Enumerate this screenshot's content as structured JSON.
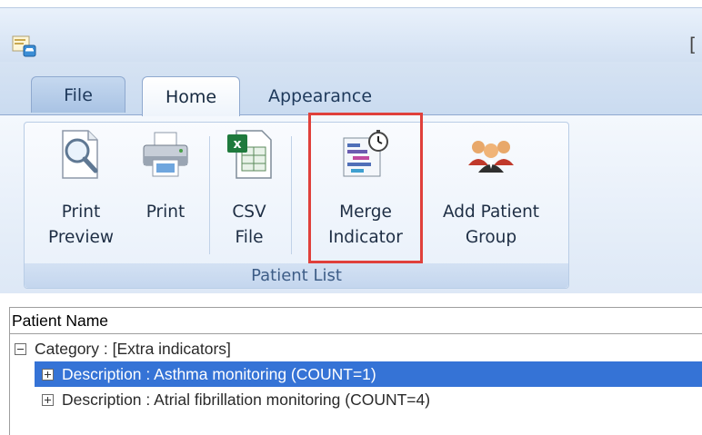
{
  "window": {
    "title_fragment": "["
  },
  "tabs": [
    {
      "label": "File"
    },
    {
      "label": "Home"
    },
    {
      "label": "Appearance"
    }
  ],
  "ribbon": {
    "group_caption": "Patient List",
    "buttons": [
      {
        "line1": "Print",
        "line2": "Preview",
        "icon": "print-preview-icon"
      },
      {
        "line1": "Print",
        "line2": "",
        "icon": "printer-icon"
      },
      {
        "line1": "CSV",
        "line2": "File",
        "icon": "csv-excel-icon"
      },
      {
        "line1": "Merge",
        "line2": "Indicator",
        "icon": "merge-indicator-icon"
      },
      {
        "line1": "Add Patient",
        "line2": "Group",
        "icon": "patient-group-icon"
      }
    ]
  },
  "grid": {
    "header": "Patient Name",
    "rows": [
      {
        "text": "Category : [Extra indicators]",
        "expander": "minus"
      },
      {
        "text": "Description : Asthma monitoring (COUNT=1)",
        "expander": "plus",
        "selected": true
      },
      {
        "text": "Description : Atrial fibrillation monitoring (COUNT=4)",
        "expander": "plus"
      }
    ]
  },
  "colors": {
    "highlight_border": "#e0403b",
    "selected_row": "#3573d6"
  }
}
